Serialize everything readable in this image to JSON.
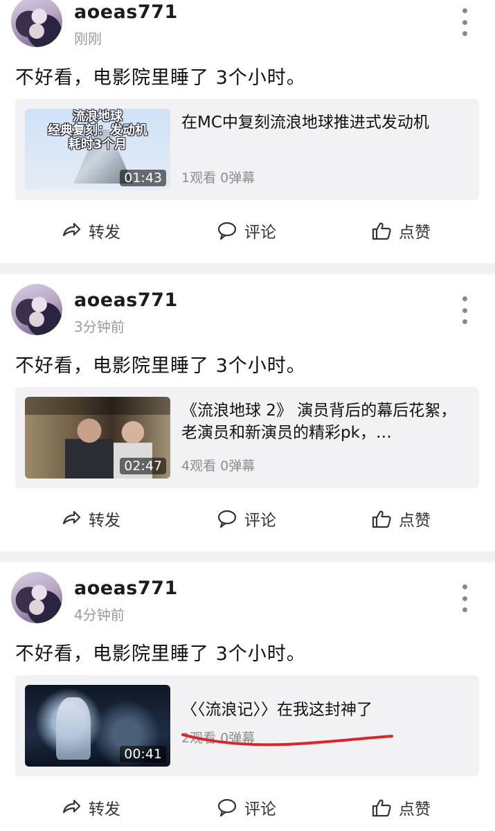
{
  "posts": [
    {
      "username": "aoeas771",
      "time": "刚刚",
      "content": "不好看，电影院里睡了 3个小时。",
      "video": {
        "title": "在MC中复刻流浪地球推进式发动机",
        "stats": "1观看 0弹幕",
        "duration": "01:43",
        "thumb_text": "流浪地球\n经典复刻：发动机\n耗时3个月"
      }
    },
    {
      "username": "aoeas771",
      "time": "3分钟前",
      "content": "不好看，电影院里睡了 3个小时。",
      "video": {
        "title": "《流浪地球 2》 演员背后的幕后花絮，老演员和新演员的精彩pk，…",
        "stats": "4观看 0弹幕",
        "duration": "02:47"
      }
    },
    {
      "username": "aoeas771",
      "time": "4分钟前",
      "content": "不好看，电影院里睡了 3个小时。",
      "video": {
        "title": "〈〈流浪记〉〉在我这封神了",
        "stats": "2观看 0弹幕",
        "duration": "00:41"
      }
    }
  ],
  "actions": {
    "repost": "转发",
    "comment": "评论",
    "like": "点赞"
  },
  "colors": {
    "card_bg": "#f2f2f4",
    "separator": "#f1f1f3",
    "annotation_red": "#d9262b"
  }
}
